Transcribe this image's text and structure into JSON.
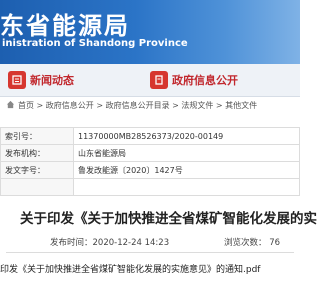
{
  "header": {
    "title_cn": "东省能源局",
    "title_en": "inistration of Shandong Province"
  },
  "nav": {
    "news_label": "新闻动态",
    "open_label": "政府信息公开"
  },
  "breadcrumb": {
    "text": "首页 > 政府信息公开 > 政府信息公开目录 > 法规文件 > 其他文件"
  },
  "info": {
    "rows": [
      {
        "key": "索引号：",
        "value": "11370000MB28526373/2020-00149"
      },
      {
        "key": "发布机构：",
        "value": "山东省能源局"
      },
      {
        "key": "发文字号：",
        "value": "鲁发改能源〔2020〕1427号"
      },
      {
        "key": "",
        "value": ""
      }
    ]
  },
  "doc": {
    "title": "关于印发《关于加快推进全省煤矿智能化发展的实",
    "date": "发布时间：2020-12-24 14:23",
    "views": "浏览次数： 76",
    "attachment": "印发《关于加快推进全省煤矿智能化发展的实施意见》的通知.pdf"
  },
  "colors": {
    "header_blue": "#1d5fb0",
    "nav_red": "#c1272d"
  }
}
